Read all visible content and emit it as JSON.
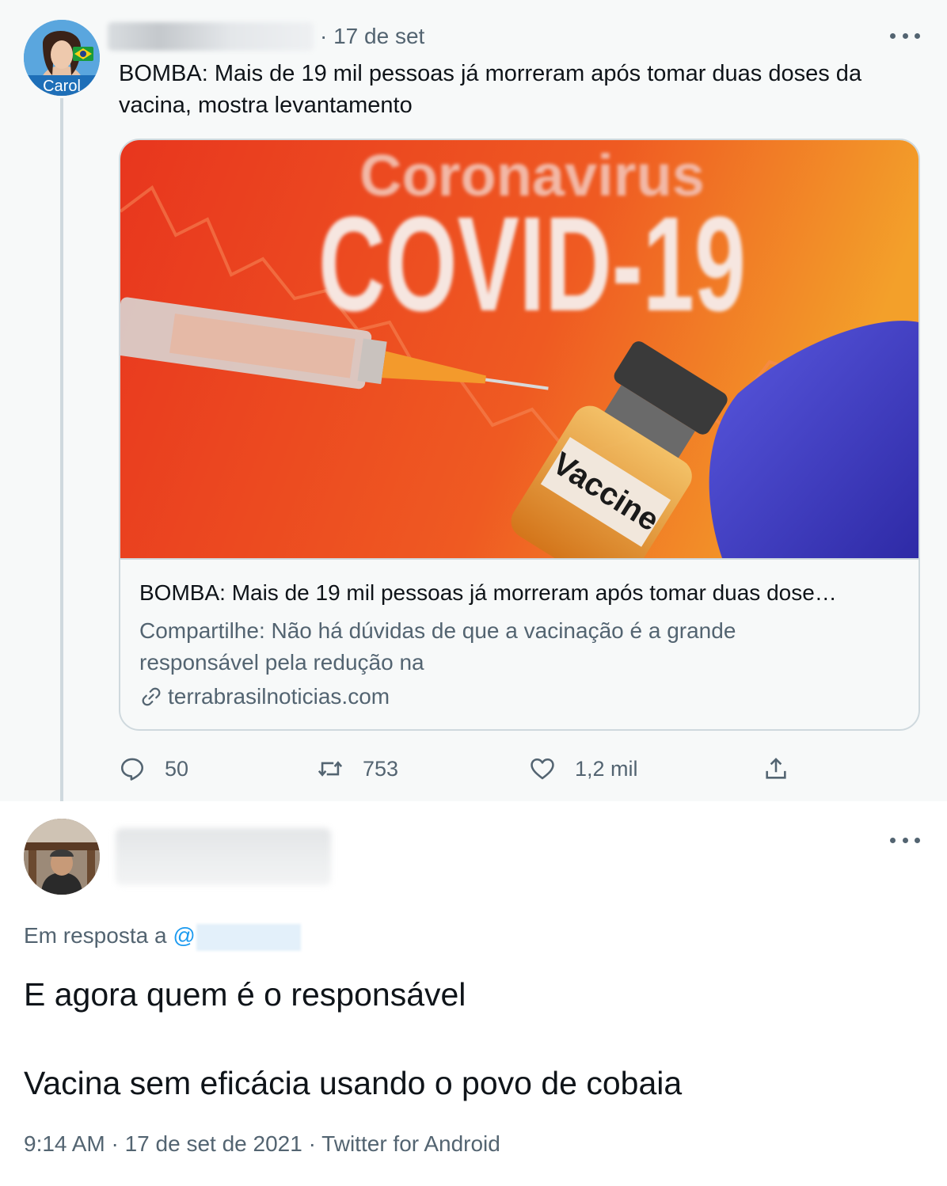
{
  "parent_tweet": {
    "avatar_label": "Carol",
    "date": "· 17 de set",
    "text": "BOMBA: Mais de 19 mil pessoas já morreram após tomar duas doses da vacina, mostra levantamento",
    "card": {
      "image_text_top": "Coronavirus",
      "image_text_main": "COVID-19",
      "image_vial_label": "Vaccine",
      "title": "BOMBA: Mais de 19 mil pessoas já morreram após tomar duas dose…",
      "description": "Compartilhe: Não há dúvidas de que a vacinação é a grande responsável pela redução na",
      "domain": "terrabrasilnoticias.com"
    },
    "actions": {
      "replies": "50",
      "retweets": "753",
      "likes": "1,2 mil"
    }
  },
  "reply_tweet": {
    "reply_prefix": "Em resposta a ",
    "reply_at": "@",
    "text_line1": "E agora quem é o responsável",
    "text_line2": "Vacina sem eficácia usando o povo de cobaia",
    "meta": "9:14 AM · 17 de set de 2021 · Twitter for Android"
  },
  "colors": {
    "secondary_text": "#536471",
    "link_blue": "#1d9bf0",
    "parent_bg": "#f7f9f9",
    "border": "#cfd9de"
  },
  "icons": [
    "more-icon",
    "reply-icon",
    "retweet-icon",
    "like-icon",
    "share-icon",
    "link-icon"
  ]
}
